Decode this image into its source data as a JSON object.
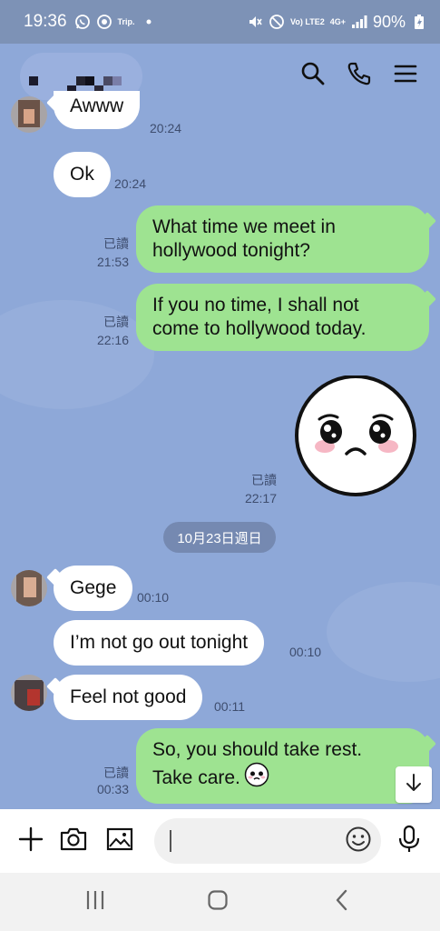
{
  "status_bar": {
    "time": "19:36",
    "trip_label": "Trip.",
    "network_label": "Vo) LTE2",
    "network_type": "4G+",
    "battery": "90%",
    "icons": [
      "whatsapp-icon",
      "browser-icon",
      "dot-icon",
      "mute-icon",
      "block-icon",
      "signal-icon",
      "battery-icon"
    ]
  },
  "header": {
    "contact_name_hidden": true,
    "actions": [
      "search-icon",
      "phone-icon",
      "menu-icon"
    ]
  },
  "messages": [
    {
      "id": "m1",
      "side": "in",
      "text": "Awww",
      "time": "20:24"
    },
    {
      "id": "m2",
      "side": "in",
      "text": "Ok",
      "time": "20:24"
    },
    {
      "id": "m3",
      "side": "out",
      "line1": "What time we meet in",
      "line2": "hollywood tonight?",
      "read": "已讀",
      "time": "21:53"
    },
    {
      "id": "m4",
      "side": "out",
      "line1": "If you no time,  I shall not",
      "line2": "come to hollywood today.",
      "read": "已讀",
      "time": "22:16"
    },
    {
      "id": "m5",
      "side": "out",
      "type": "sticker",
      "sticker": "crying-face-sticker",
      "read": "已讀",
      "time": "22:17"
    },
    {
      "id": "date",
      "type": "date",
      "text": "10月23日週日"
    },
    {
      "id": "m6",
      "side": "in",
      "text": "Gege",
      "time": "00:10"
    },
    {
      "id": "m7",
      "side": "in",
      "text": "I’m not go out tonight",
      "time": "00:10"
    },
    {
      "id": "m8",
      "side": "in",
      "text": "Feel not good",
      "time": "00:11"
    },
    {
      "id": "m9",
      "side": "out",
      "line1": "So, you should take rest.",
      "line2": "Take care.",
      "emoji": "crying-face-emoji",
      "read": "已讀",
      "time": "00:33"
    }
  ],
  "input_bar": {
    "value": "",
    "placeholder": "",
    "buttons": [
      "plus-icon",
      "camera-icon",
      "image-icon",
      "emoji-icon",
      "microphone-icon"
    ]
  },
  "nav_bar": {
    "buttons": [
      "recent-apps-icon",
      "home-icon",
      "back-icon"
    ]
  },
  "colors": {
    "background": "#8ea8d8",
    "status_bar": "#7d92b6",
    "outgoing_bubble": "#9ee391",
    "incoming_bubble": "#ffffff",
    "date_pill": "#7589b1",
    "meta_text": "#3e4d6e"
  }
}
